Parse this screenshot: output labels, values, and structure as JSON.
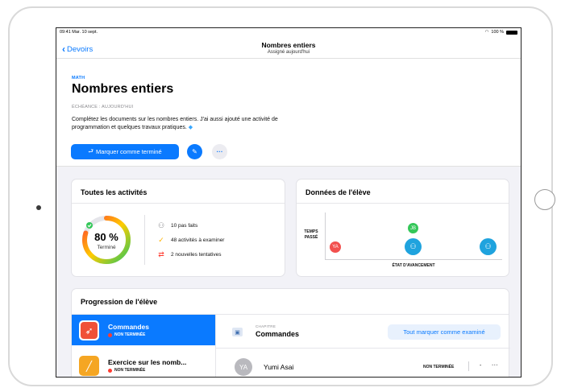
{
  "status_bar": {
    "time": "09:41  Mar. 10 sept.",
    "battery": "100 %"
  },
  "nav": {
    "back_label": "Devoirs",
    "title": "Nombres entiers",
    "subtitle": "Assigné aujourd'hui"
  },
  "assignment": {
    "subject": "MATH",
    "title": "Nombres entiers",
    "due": "ÉCHÉANCE : AUJOURD'HUI",
    "description": "Complétez les documents sur les nombres entiers. J'ai aussi ajouté une activité de programmation et quelques travaux pratiques.",
    "mark_done_label": "Marquer comme terminé"
  },
  "activities": {
    "title": "Toutes les activités",
    "percent": "80 %",
    "percent_value": 80,
    "percent_label": "Terminé",
    "stats": [
      {
        "icon": "people-icon",
        "text": "10 pas faits"
      },
      {
        "icon": "check-icon",
        "text": "48 activités à examiner"
      },
      {
        "icon": "retry-icon",
        "text": "2 nouvelles tentatives"
      }
    ]
  },
  "student_data": {
    "title": "Données de l'élève",
    "y_label_line1": "TEMPS",
    "y_label_line2": "PASSÉ",
    "x_label": "ÉTAT D'AVANCEMENT",
    "dots": [
      {
        "label": "YA",
        "color": "#f2504e"
      },
      {
        "label": "JB",
        "color": "#34c759"
      },
      {
        "label": "group-icon",
        "color": "#1fa3de"
      },
      {
        "label": "group-icon",
        "color": "#1fa3de"
      }
    ]
  },
  "progress": {
    "title": "Progression de l'élève",
    "items": [
      {
        "name": "Commandes",
        "status": "NON TERMINÉE",
        "icon": "swift-icon",
        "icon_color": "#f05138"
      },
      {
        "name": "Exercice sur les nomb...",
        "status": "NON TERMINÉE",
        "icon": "pencil-doc-icon",
        "icon_color": "#f5a623"
      }
    ],
    "chapter_label": "CHAPITRE",
    "chapter_name": "Commandes",
    "mark_all_label": "Tout marquer comme examiné",
    "student": {
      "initials": "YA",
      "name": "Yumi Asai",
      "status": "NON TERMINÉE",
      "score": "-"
    }
  }
}
